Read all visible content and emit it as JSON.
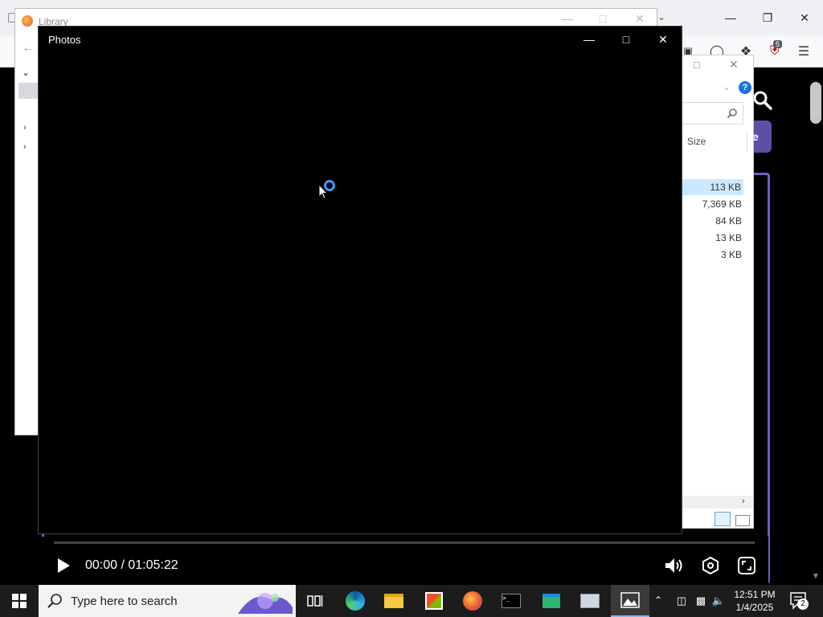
{
  "browser": {
    "ublock_badge": "5"
  },
  "library": {
    "title": "Library"
  },
  "explorer": {
    "help_glyph": "?",
    "size_header": "Size",
    "sizes": [
      "113 KB",
      "7,369 KB",
      "84 KB",
      "13 KB",
      "3 KB"
    ]
  },
  "photos": {
    "title": "Photos",
    "current_time": "00:00 / 01:05:22",
    "progress": 0
  },
  "taskbar": {
    "search_placeholder": "Type here to search",
    "clock_time": "12:51 PM",
    "clock_date": "1/4/2025",
    "notification_count": "2",
    "apps": [
      "task-view",
      "edge",
      "file-explorer",
      "microsoft-store",
      "firefox",
      "terminal",
      "app-installer",
      "remote-desktop",
      "photos"
    ]
  },
  "colors": {
    "accent": "#6b5fc7",
    "taskbar": "#1c1c1c",
    "spinner": "#3b9cff"
  }
}
